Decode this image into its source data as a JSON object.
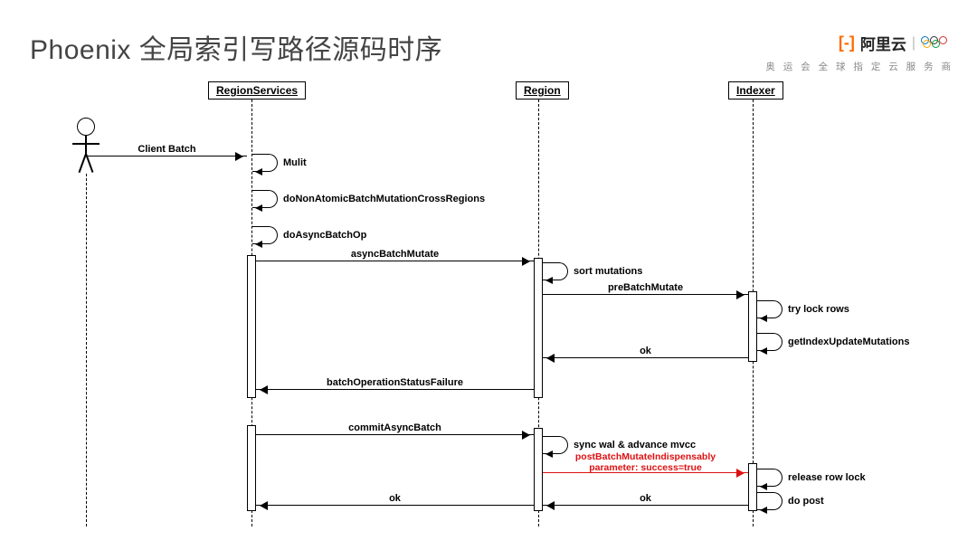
{
  "title": "Phoenix 全局索引写路径源码时序",
  "brand": {
    "logo_text": "阿里云",
    "tagline": "奥 运 会 全 球 指 定 云 服 务 商"
  },
  "participants": {
    "region_services": "RegionServices",
    "region": "Region",
    "indexer": "Indexer"
  },
  "messages": {
    "client_batch": "Client Batch",
    "mulit": "Mulit",
    "do_non_atomic": "doNonAtomicBatchMutationCrossRegions",
    "do_async_batch_op": "doAsyncBatchOp",
    "async_batch_mutate": "asyncBatchMutate",
    "sort_mutations": "sort mutations",
    "pre_batch_mutate": "preBatchMutate",
    "try_lock_rows": "try lock rows",
    "get_index_update": "getIndexUpdateMutations",
    "ok": "ok",
    "batch_op_status_failure": "batchOperationStatusFailure",
    "commit_async_batch": "commitAsyncBatch",
    "sync_wal": "sync wal & advance mvcc",
    "post_batch_mutate": "postBatchMutateIndispensably\nparameter: success=true",
    "release_row_lock": "release row lock",
    "do_post": "do post"
  }
}
